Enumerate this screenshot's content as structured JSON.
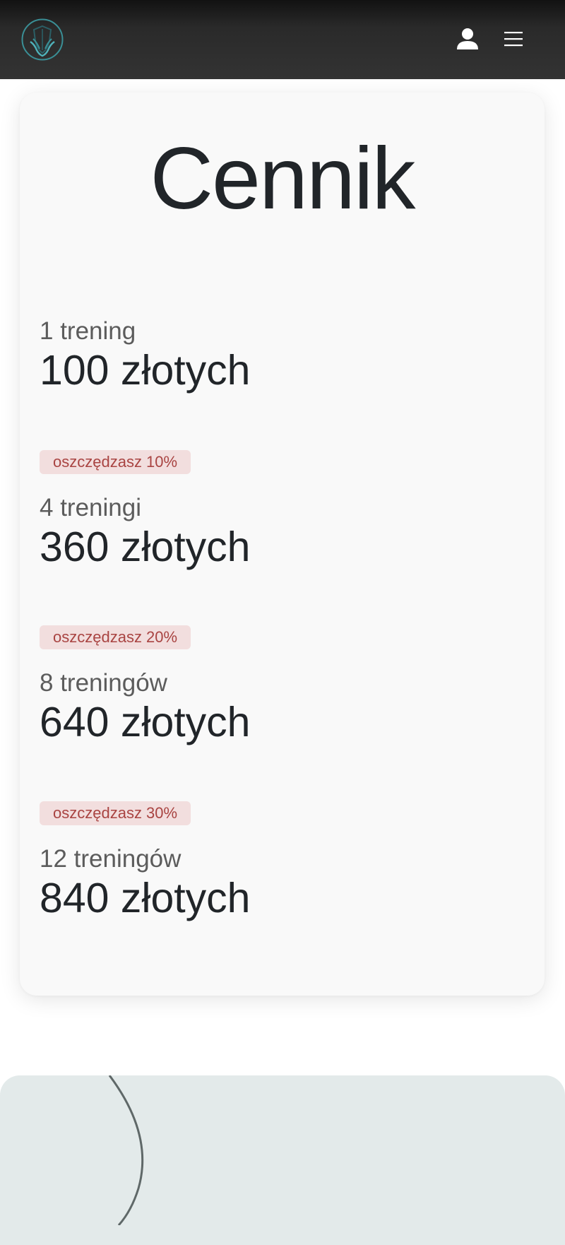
{
  "header": {
    "logo_icon": "shield-wings-logo",
    "user_icon": "user-icon",
    "menu_icon": "hamburger-menu-icon",
    "accent_color": "#3a8f96"
  },
  "pricing": {
    "title": "Cennik",
    "items": [
      {
        "label": "1 trening",
        "price": "100 złotych",
        "badge": ""
      },
      {
        "label": "4 treningi",
        "price": "360 złotych",
        "badge": "oszczędzasz 10%"
      },
      {
        "label": "8 treningów",
        "price": "640 złotych",
        "badge": "oszczędzasz 20%"
      },
      {
        "label": "12 treningów",
        "price": "840 złotych",
        "badge": "oszczędzasz 30%"
      }
    ]
  }
}
